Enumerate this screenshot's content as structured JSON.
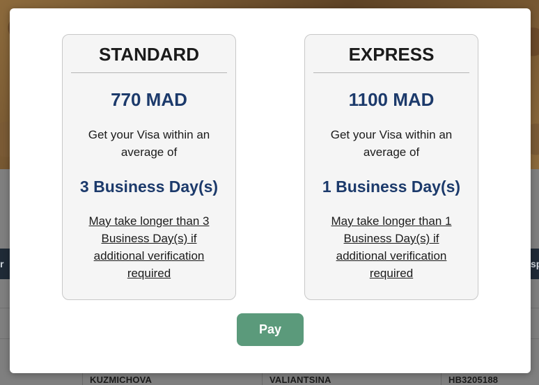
{
  "background": {
    "bar_left_text": "r",
    "bar_right_text": "sp",
    "row_cells": [
      "KUZMICHOVA",
      "VALIANTSINA",
      "HB3205188"
    ]
  },
  "modal": {
    "plans": [
      {
        "title": "STANDARD",
        "price": "770 MAD",
        "description": "Get your Visa within an average of",
        "days": "3 Business Day(s)",
        "note": "May take longer than 3 Business Day(s) if additional verification required"
      },
      {
        "title": "EXPRESS",
        "price": "1100 MAD",
        "description": "Get your Visa within an average of",
        "days": "1 Business Day(s)",
        "note": "May take longer than 1 Business Day(s) if additional verification required"
      }
    ],
    "pay_label": "Pay"
  },
  "colors": {
    "accent_blue": "#1c3a6b",
    "pay_green": "#5b9a7b"
  }
}
